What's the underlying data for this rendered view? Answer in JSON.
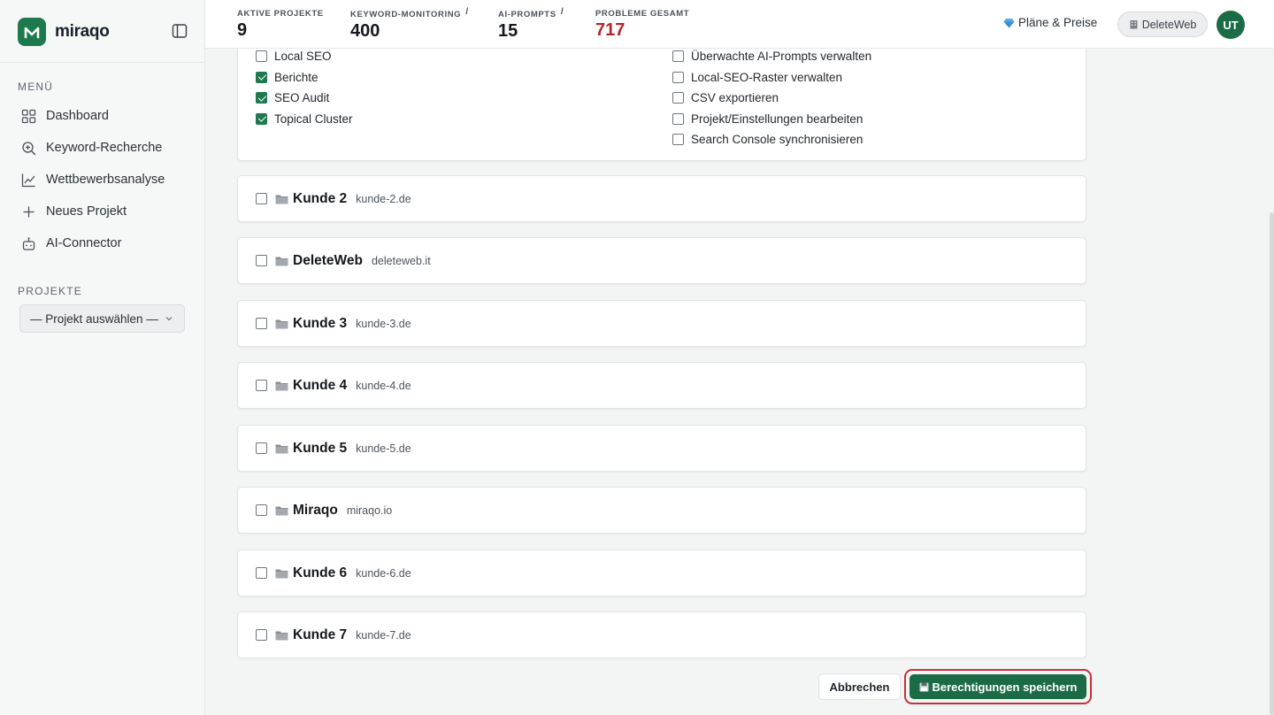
{
  "brand": {
    "name": "miraqo"
  },
  "sidebar": {
    "menu_label": "MENÜ",
    "items": [
      {
        "label": "Dashboard",
        "icon": "grid-icon"
      },
      {
        "label": "Keyword-Recherche",
        "icon": "search-plus-icon"
      },
      {
        "label": "Wettbewerbsanalyse",
        "icon": "chart-line-icon"
      },
      {
        "label": "Neues Projekt",
        "icon": "plus-icon"
      },
      {
        "label": "AI-Connector",
        "icon": "robot-icon"
      }
    ],
    "projects_label": "PROJEKTE",
    "project_select": {
      "value": "— Projekt auswählen —"
    }
  },
  "topbar": {
    "stats": [
      {
        "label": "AKTIVE PROJEKTE",
        "value": "9",
        "info": ""
      },
      {
        "label": "KEYWORD-MONITORING",
        "value": "400",
        "info": "i"
      },
      {
        "label": "AI-PROMPTS",
        "value": "15",
        "info": "i"
      },
      {
        "label": "PROBLEME GESAMT",
        "value": "717",
        "info": ""
      }
    ],
    "plans_label": "Pläne & Preise",
    "workspace_label": "DeleteWeb",
    "avatar_initials": "UT"
  },
  "permissions": {
    "left": [
      {
        "label": "Local SEO",
        "checked": false
      },
      {
        "label": "Berichte",
        "checked": true
      },
      {
        "label": "SEO Audit",
        "checked": true
      },
      {
        "label": "Topical Cluster",
        "checked": true
      }
    ],
    "right": [
      {
        "label": "Überwachte AI-Prompts verwalten",
        "checked": false
      },
      {
        "label": "Local-SEO-Raster verwalten",
        "checked": false
      },
      {
        "label": "CSV exportieren",
        "checked": false
      },
      {
        "label": "Projekt/Einstellungen bearbeiten",
        "checked": false
      },
      {
        "label": "Search Console synchronisieren",
        "checked": false
      }
    ]
  },
  "projects": [
    {
      "name": "Kunde 2",
      "domain": "kunde-2.de",
      "checked": false
    },
    {
      "name": "DeleteWeb",
      "domain": "deleteweb.it",
      "checked": false
    },
    {
      "name": "Kunde 3",
      "domain": "kunde-3.de",
      "checked": false
    },
    {
      "name": "Kunde 4",
      "domain": "kunde-4.de",
      "checked": false
    },
    {
      "name": "Kunde 5",
      "domain": "kunde-5.de",
      "checked": false
    },
    {
      "name": "Miraqo",
      "domain": "miraqo.io",
      "checked": false
    },
    {
      "name": "Kunde 6",
      "domain": "kunde-6.de",
      "checked": false
    },
    {
      "name": "Kunde 7",
      "domain": "kunde-7.de",
      "checked": false
    }
  ],
  "actions": {
    "cancel_label": "Abbrechen",
    "save_label": "Berechtigungen speichern"
  },
  "colors": {
    "accent": "#1c6b47",
    "danger": "#b3262e",
    "highlight_ring": "#c8313b"
  }
}
